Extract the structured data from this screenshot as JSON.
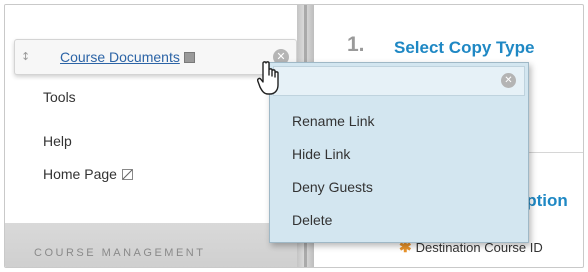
{
  "course_menu": {
    "selected_item": {
      "label": "Course Documents",
      "drag_handle_glyph": "↕",
      "options_glyph": "✕"
    },
    "items": [
      {
        "label": "Tools"
      },
      {
        "label": "Help"
      },
      {
        "label": "Home Page"
      }
    ],
    "management_header": "COURSE MANAGEMENT"
  },
  "content": {
    "step_number": "1.",
    "step_title": "Select Copy Type",
    "section_title_partial": "Option",
    "destination_label": "Destination Course ID",
    "required_glyph": "✱"
  },
  "context_menu": {
    "close_glyph": "✕",
    "items": [
      {
        "label": "Rename Link"
      },
      {
        "label": "Hide Link"
      },
      {
        "label": "Deny Guests"
      },
      {
        "label": "Delete"
      }
    ]
  },
  "colors": {
    "link": "#2c64a6",
    "heading": "#1f88c4",
    "menu_bg": "#d3e6f0",
    "required": "#e8932a"
  },
  "icons": {
    "square_indicator": "square-icon",
    "edit": "edit-icon",
    "cursor": "hand-pointer-icon"
  }
}
